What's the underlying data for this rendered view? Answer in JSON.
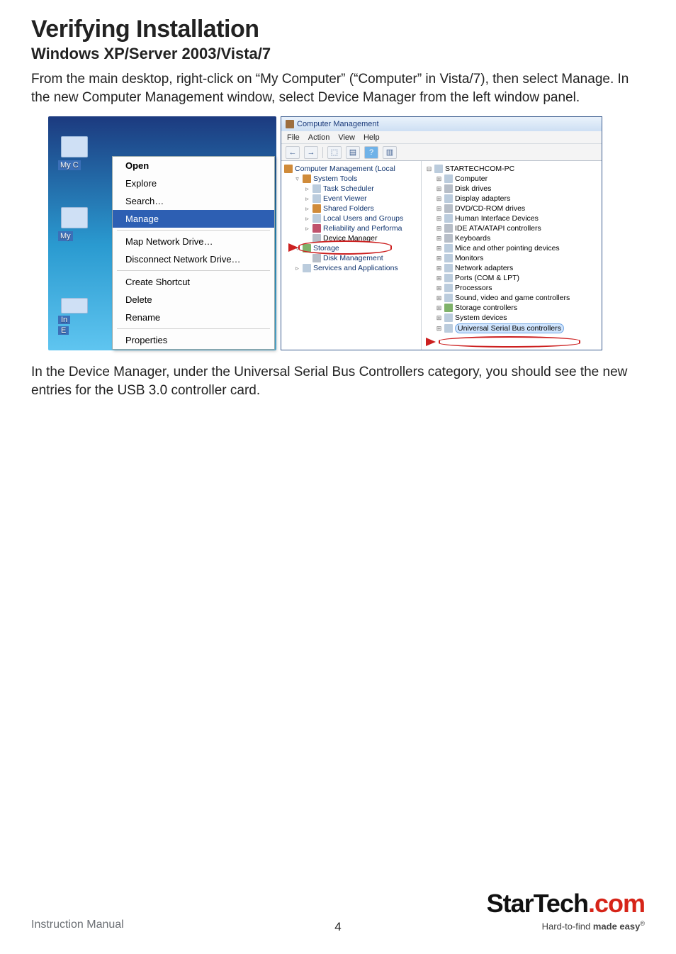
{
  "doc": {
    "title": "Verifying Installation",
    "subtitle": "Windows XP/Server 2003/Vista/7",
    "intro": "From the main desktop, right-click on “My Computer” (“Computer” in Vista/7), then select Manage. In the new Computer Management window, select Device Manager from the left window panel.",
    "outro": "In the Device Manager, under the Universal Serial Bus Controllers category, you should see the new entries for the USB 3.0 controller card.",
    "footer_label": "Instruction Manual",
    "page_number": "4",
    "logo_text_a": "StarTech",
    "logo_text_b": ".com",
    "logo_tagline_a": "Hard-to-find ",
    "logo_tagline_b": "made easy",
    "logo_reg": "®"
  },
  "context_menu": {
    "icon_label_1": "My C",
    "icon_label_2": "My",
    "icon_label_3": "In",
    "icon_label_4": "E",
    "items": {
      "open": "Open",
      "explore": "Explore",
      "search": "Search…",
      "manage": "Manage",
      "map": "Map Network Drive…",
      "disconnect": "Disconnect Network Drive…",
      "shortcut": "Create Shortcut",
      "delete": "Delete",
      "rename": "Rename",
      "properties": "Properties"
    }
  },
  "mgmt": {
    "window_title": "Computer Management",
    "menu": {
      "file": "File",
      "action": "Action",
      "view": "View",
      "help": "Help"
    },
    "toolbar_icons": {
      "back": "←",
      "fwd": "→",
      "up": "⬚",
      "props": "▤",
      "help": "?",
      "more": "▥"
    },
    "tree": {
      "root": "Computer Management (Local",
      "system_tools": "System Tools",
      "task_scheduler": "Task Scheduler",
      "event_viewer": "Event Viewer",
      "shared_folders": "Shared Folders",
      "local_users": "Local Users and Groups",
      "reliability": "Reliability and Performa",
      "device_manager": "Device Manager",
      "storage": "Storage",
      "disk_mgmt": "Disk Management",
      "services": "Services and Applications"
    },
    "devices": {
      "root": "STARTECHCOM-PC",
      "computer": "Computer",
      "disk": "Disk drives",
      "display": "Display adapters",
      "dvd": "DVD/CD-ROM drives",
      "hid": "Human Interface Devices",
      "ide": "IDE ATA/ATAPI controllers",
      "keyboards": "Keyboards",
      "mice": "Mice and other pointing devices",
      "monitors": "Monitors",
      "network": "Network adapters",
      "ports": "Ports (COM & LPT)",
      "processors": "Processors",
      "sound": "Sound, video and game controllers",
      "storage_ctl": "Storage controllers",
      "system_dev": "System devices",
      "usb": "Universal Serial Bus controllers"
    }
  }
}
